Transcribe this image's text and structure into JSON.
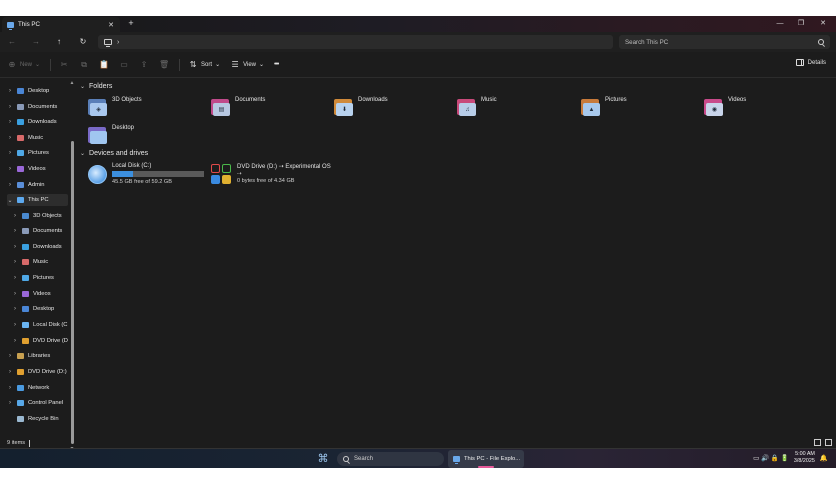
{
  "window": {
    "tab_title": "This PC",
    "tab_close": "✕",
    "new_tab": "+",
    "minimize": "—",
    "maximize": "❐",
    "close": "✕"
  },
  "nav": {
    "back": "←",
    "forward": "→",
    "up": "↑",
    "refresh": "↻",
    "breadcrumb_chevron": "›",
    "search_placeholder": "Search This PC"
  },
  "toolbar": {
    "new_label": "New",
    "new_glyph": "⊕",
    "cut_glyph": "✂",
    "copy_glyph": "⧉",
    "paste_glyph": "📋",
    "rename_glyph": "▭",
    "share_glyph": "⇪",
    "delete_glyph": "🗑",
    "sort_glyph": "⇅",
    "sort_label": "Sort",
    "view_glyph": "☰",
    "view_label": "View",
    "more_glyph": "•••",
    "details_label": "Details",
    "dropdown": "⌄"
  },
  "sidebar": {
    "items": [
      {
        "label": "Desktop",
        "color": "#4a86d6",
        "expander": "›"
      },
      {
        "label": "Documents",
        "color": "#8a9ab8",
        "expander": "›"
      },
      {
        "label": "Downloads",
        "color": "#3aa0e0",
        "expander": "›"
      },
      {
        "label": "Music",
        "color": "#d86a6a",
        "expander": "›"
      },
      {
        "label": "Pictures",
        "color": "#4fa8e6",
        "expander": "›"
      },
      {
        "label": "Videos",
        "color": "#9a68d8",
        "expander": "›"
      },
      {
        "label": "Admin",
        "color": "#5a8ed8",
        "expander": "›"
      },
      {
        "label": "This PC",
        "color": "#5da9ef",
        "expander": "⌄"
      },
      {
        "label": "3D Objects",
        "color": "#4a8ad0",
        "expander": "›"
      },
      {
        "label": "Documents",
        "color": "#8a9ab8",
        "expander": "›"
      },
      {
        "label": "Downloads",
        "color": "#3aa0e0",
        "expander": "›"
      },
      {
        "label": "Music",
        "color": "#d86a6a",
        "expander": "›"
      },
      {
        "label": "Pictures",
        "color": "#4fa8e6",
        "expander": "›"
      },
      {
        "label": "Videos",
        "color": "#9a68d8",
        "expander": "›"
      },
      {
        "label": "Desktop",
        "color": "#4a86d6",
        "expander": "›"
      },
      {
        "label": "Local Disk (C",
        "color": "#6ab4f2",
        "expander": "›"
      },
      {
        "label": "DVD Drive (D",
        "color": "#e0a030",
        "expander": "›"
      },
      {
        "label": "Libraries",
        "color": "#c8a050",
        "expander": "›"
      },
      {
        "label": "DVD Drive (D:)",
        "color": "#e0a030",
        "expander": "›"
      },
      {
        "label": "Network",
        "color": "#4a9ae0",
        "expander": "›"
      },
      {
        "label": "Control Panel",
        "color": "#58a8e8",
        "expander": "›"
      },
      {
        "label": "Recycle Bin",
        "color": "#9ab8d0",
        "expander": ""
      }
    ]
  },
  "folders_section": {
    "caret": "⌄",
    "title": "Folders",
    "items": [
      {
        "label": "3D Objects",
        "back": "#5a7fb8",
        "front": "#a9c8ee",
        "glyph": "◈"
      },
      {
        "label": "Documents",
        "back": "#c04a8a",
        "front": "#b8c8e2",
        "glyph": "▤"
      },
      {
        "label": "Downloads",
        "back": "#d08a3a",
        "front": "#b8d2ee",
        "glyph": "⬇"
      },
      {
        "label": "Music",
        "back": "#c84a7a",
        "front": "#b8cde8",
        "glyph": "♫"
      },
      {
        "label": "Pictures",
        "back": "#c87a3a",
        "front": "#a8c8ec",
        "glyph": "▲"
      },
      {
        "label": "Videos",
        "back": "#c84a8a",
        "front": "#c8d4ea",
        "glyph": "◉"
      },
      {
        "label": "Desktop",
        "back": "#7a6ac8",
        "front": "#a0c6f0",
        "glyph": ""
      }
    ]
  },
  "drives_section": {
    "caret": "⌄",
    "title": "Devices and drives",
    "local_disk": {
      "title": "Local Disk (C:)",
      "used_fraction": 0.23,
      "free_text": "45.5 GB free of 59.2 GB"
    },
    "dvd_drive": {
      "title": "DVD Drive (D:) ⇢ Experimental OS",
      "sub_icon": "⇢",
      "free_text": "0 bytes free of 4.34 GB",
      "tiles": [
        "#e04a4a",
        "#4ab84a",
        "#3a8ae0",
        "#e0b030"
      ]
    }
  },
  "status": {
    "count": "9 items"
  },
  "taskbar": {
    "start_glyph": "⌘",
    "search_label": "Search",
    "app_label": "This PC - File Explo...",
    "tray_icons": "▭ 🔊 🔒 🔋",
    "time": "5:00 AM",
    "date": "3/8/2025",
    "bell": "🔔"
  }
}
